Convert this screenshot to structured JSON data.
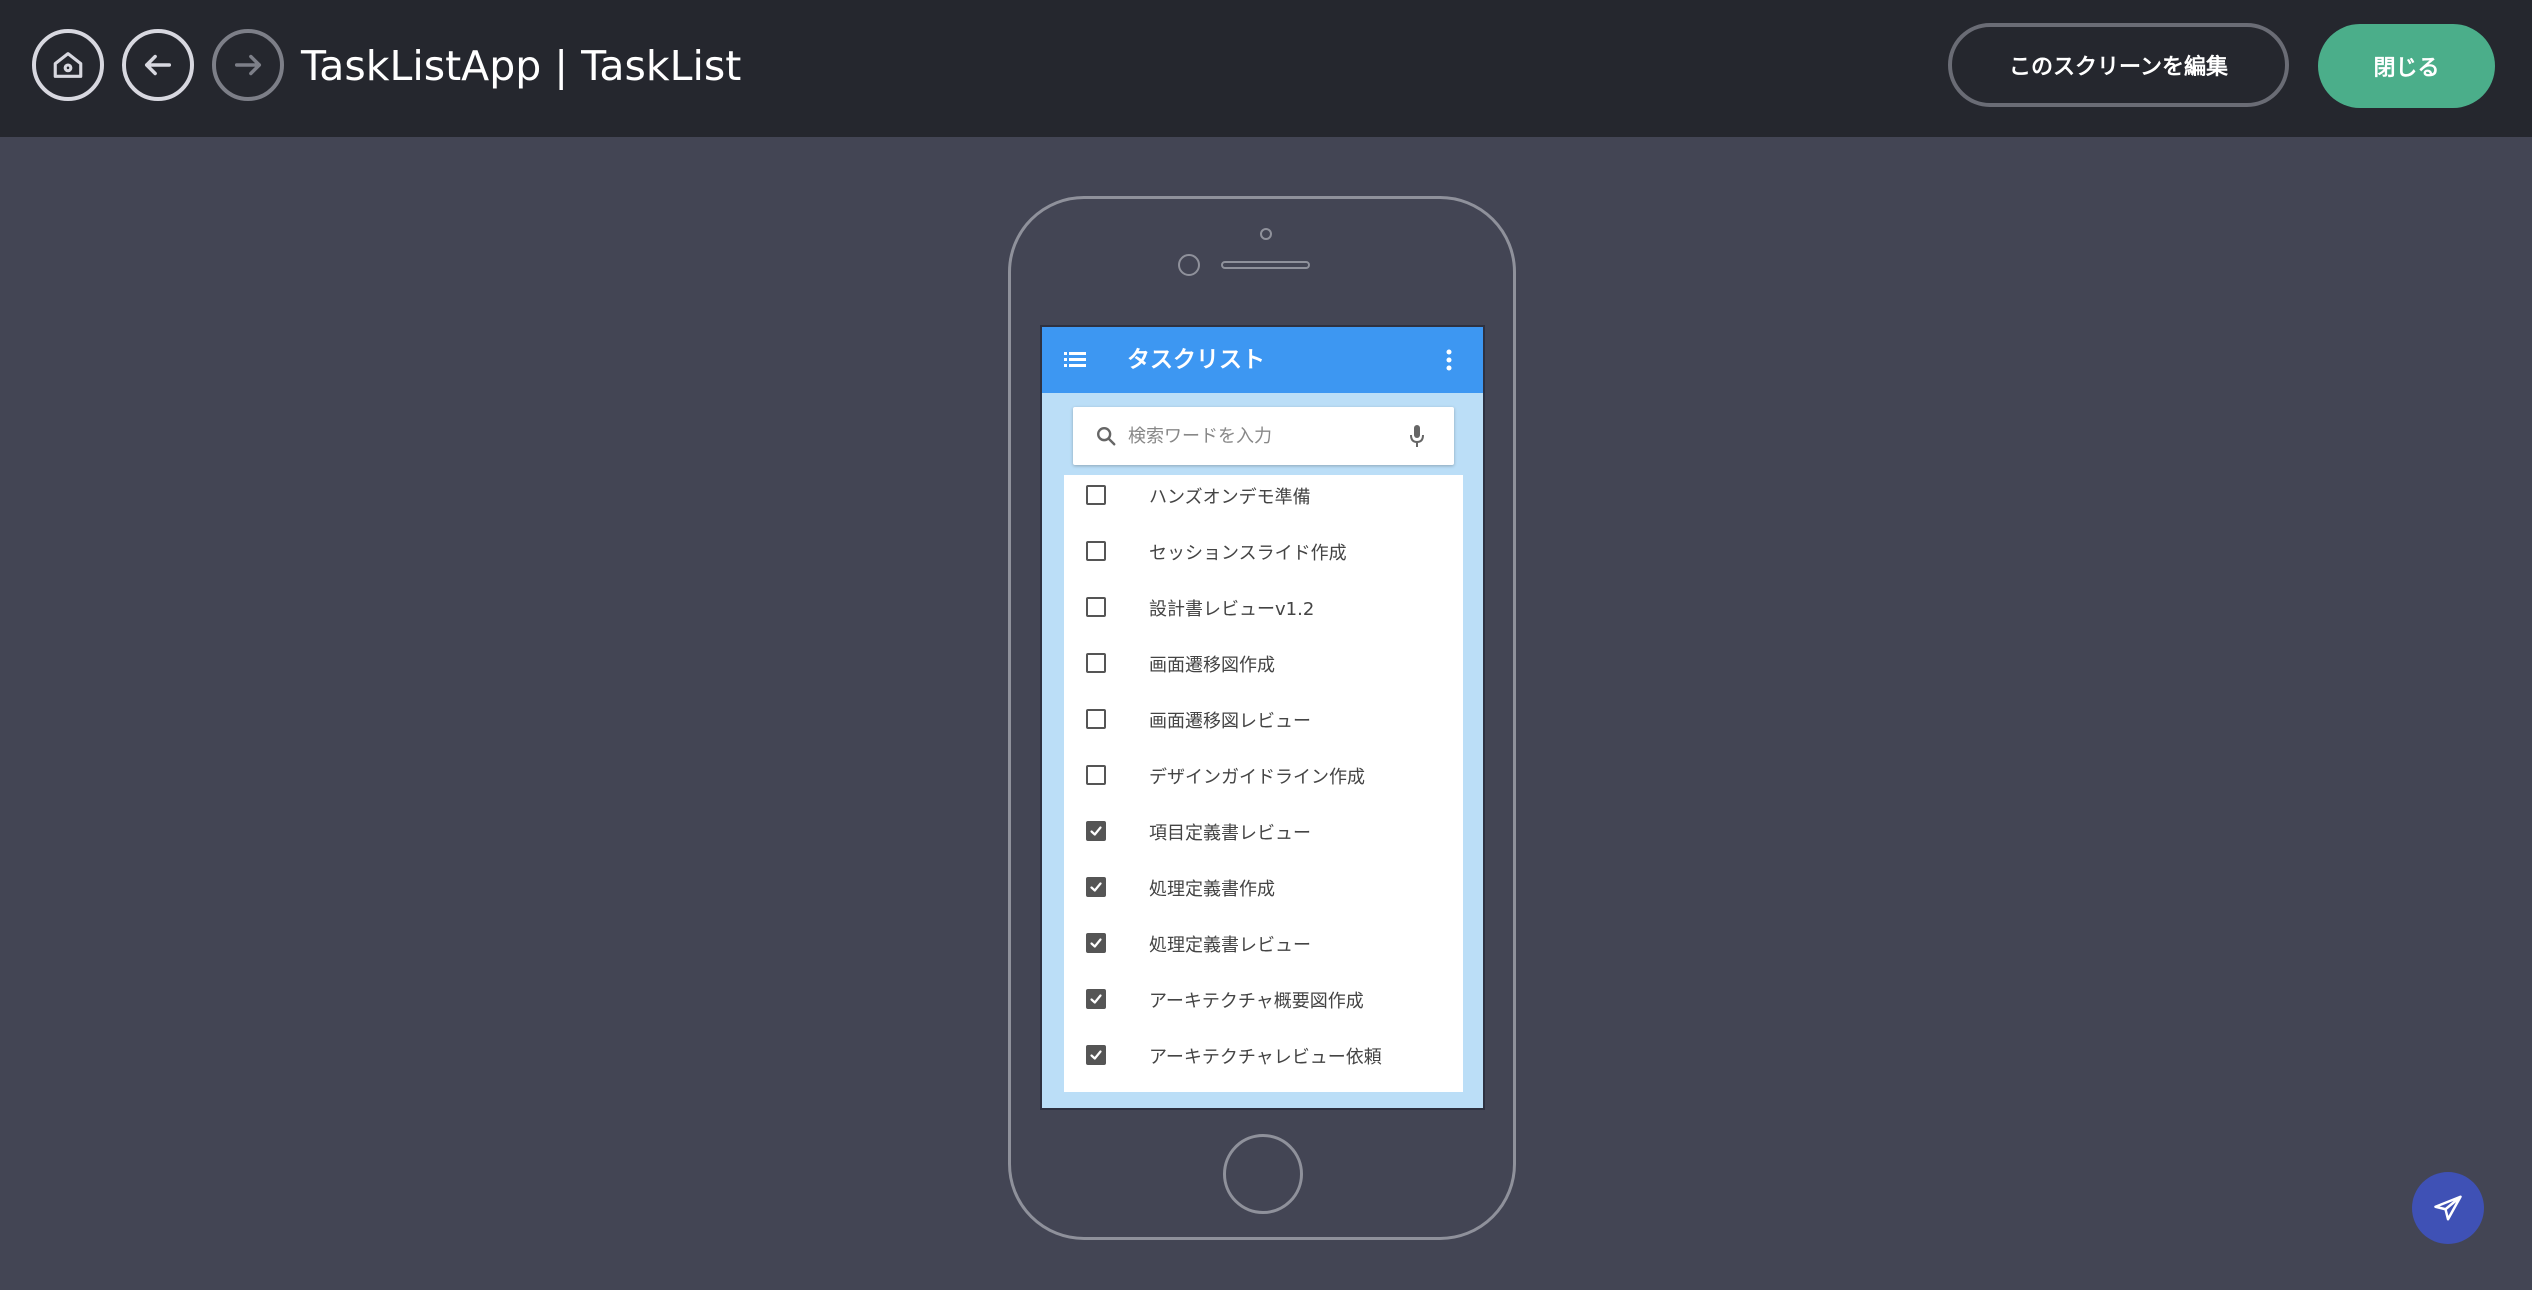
{
  "header": {
    "title": "TaskListApp | TaskList",
    "home_icon": "home-icon",
    "back_icon": "arrow-left-icon",
    "forward_icon": "arrow-right-icon",
    "edit_label": "このスクリーンを編集",
    "close_label": "閉じる"
  },
  "app": {
    "title": "タスクリスト",
    "search_placeholder": "検索ワードを入力",
    "items": [
      {
        "label": "ハンズオンデモ準備",
        "checked": false
      },
      {
        "label": "セッションスライド作成",
        "checked": false
      },
      {
        "label": "設計書レビューv1.2",
        "checked": false
      },
      {
        "label": "画面遷移図作成",
        "checked": false
      },
      {
        "label": "画面遷移図レビュー",
        "checked": false
      },
      {
        "label": "デザインガイドライン作成",
        "checked": false
      },
      {
        "label": "項目定義書レビュー",
        "checked": true
      },
      {
        "label": "処理定義書作成",
        "checked": true
      },
      {
        "label": "処理定義書レビュー",
        "checked": true
      },
      {
        "label": "アーキテクチャ概要図作成",
        "checked": true
      },
      {
        "label": "アーキテクチャレビュー依頼",
        "checked": true
      }
    ]
  },
  "colors": {
    "topbar": "#25272e",
    "background": "#434554",
    "close_button": "#4bae8a",
    "appbar": "#3d97f2",
    "screen_bg": "#bbdef7",
    "fab": "#3f51b5"
  }
}
